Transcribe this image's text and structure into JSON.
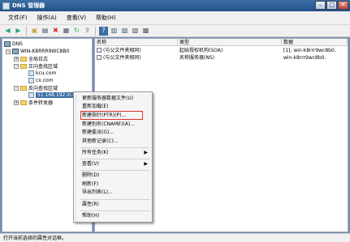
{
  "window": {
    "title": "DNS 管理器"
  },
  "menubar": [
    "文件(F)",
    "操作(A)",
    "查看(V)",
    "帮助(H)"
  ],
  "toolbar_icons": [
    "back-icon",
    "forward-icon",
    "folder-up-icon",
    "details-icon",
    "delete-icon",
    "properties-icon",
    "refresh-icon",
    "export-icon",
    "help-icon",
    "server-config-icon",
    "record-icon",
    "domain-icon",
    "update-icon"
  ],
  "tree": {
    "root": "DNS",
    "server": "WIN-K8RRR9WC8B0",
    "global_logs": "全局日志",
    "forward_zones": "正向查找区域",
    "zone1": "kcu.com",
    "zone2": "cx.com",
    "reverse_zones": "反向查找区域",
    "reverse_zone": "51.168.192.in-addr",
    "forwarders": "条件转发器"
  },
  "list": {
    "columns": [
      "名称",
      "类型",
      "数据"
    ],
    "rows": [
      [
        "(与父文件夹相同)",
        "起始授权机构(SOA)",
        "[1], win-k8rrr9wc8b0."
      ],
      [
        "(与父文件夹相同)",
        "名称服务器(NS)",
        "win-k8rrr9wc8b0."
      ]
    ]
  },
  "context_menu": {
    "items": [
      "更新服务器数据文件(U)",
      "重新加载(E)",
      "新建指针(PTR)(P)...",
      "新建别名(CNAME)(A)...",
      "新建委派(G)...",
      "其他新记录(C)...",
      "所有任务(K)",
      "查看(V)",
      "删除(D)",
      "刷新(F)",
      "导出列表(L)...",
      "属性(R)",
      "帮助(H)"
    ],
    "highlight_color": "#e0302a"
  },
  "statusbar": {
    "text": "打开当前选择的属性对话框。"
  }
}
